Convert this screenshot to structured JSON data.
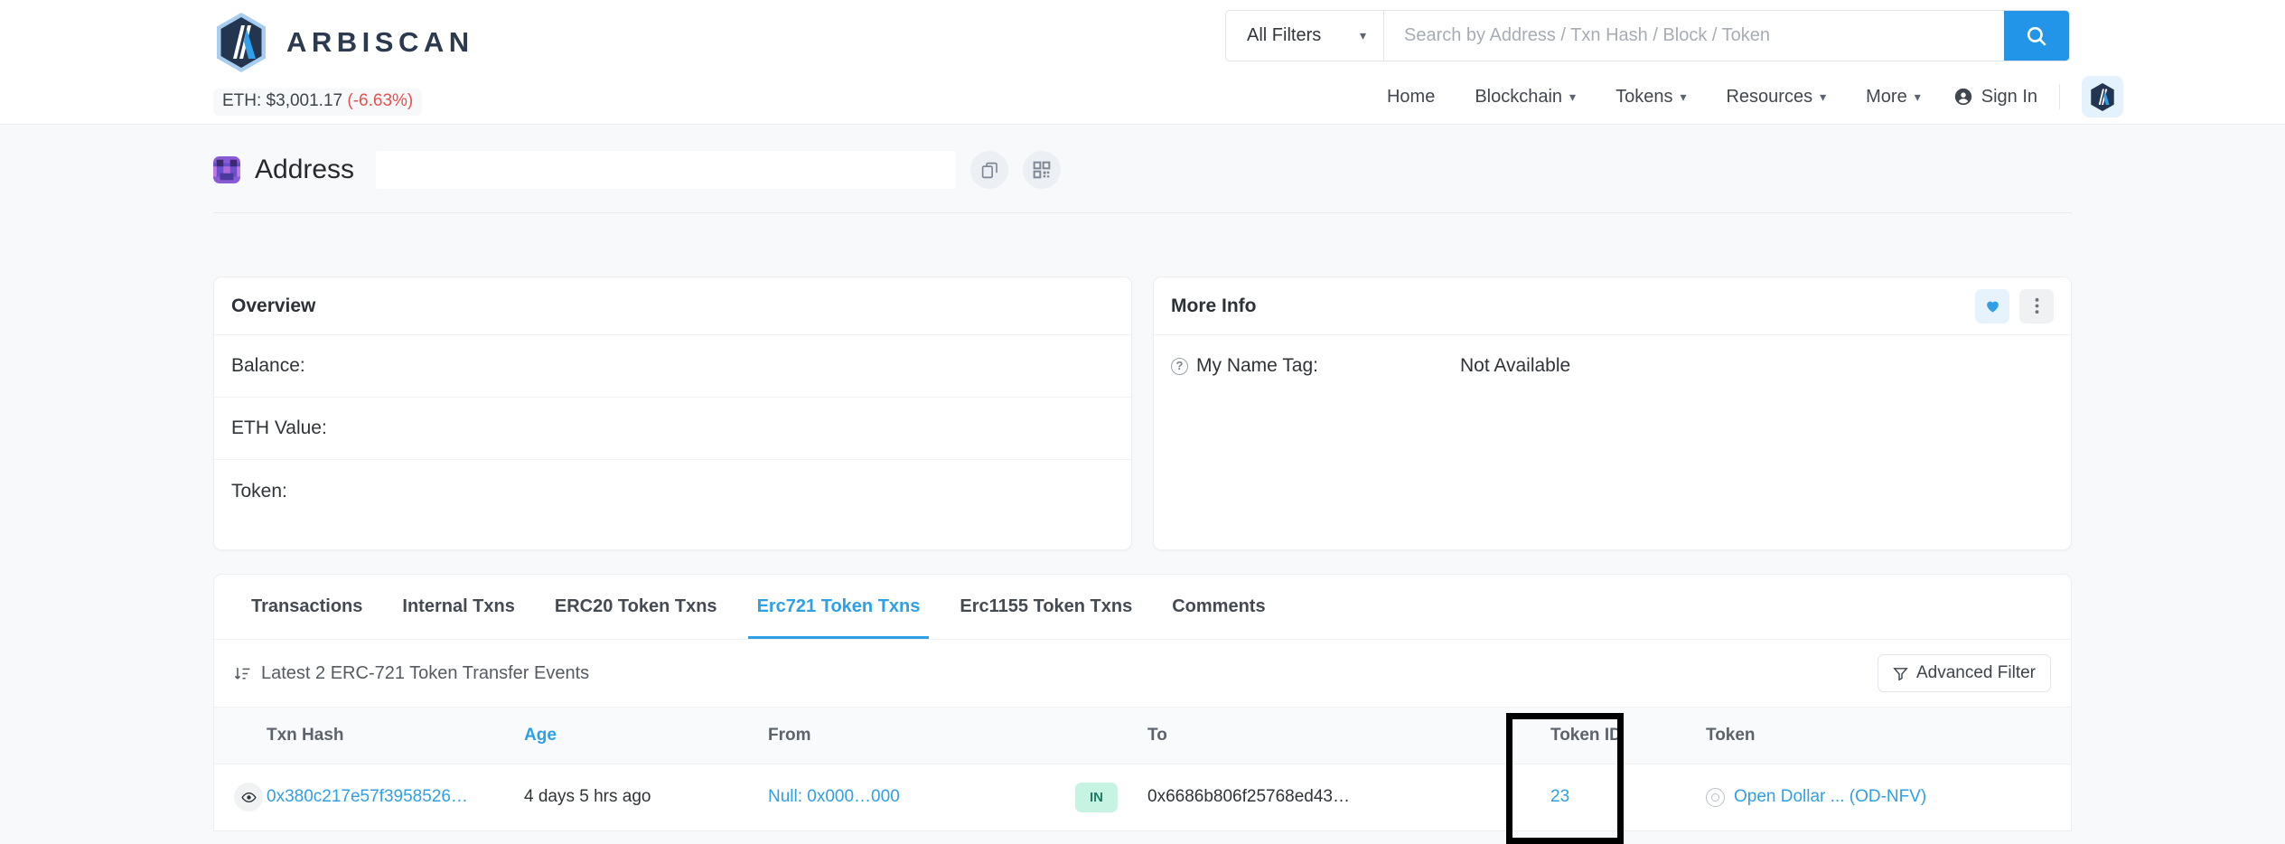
{
  "brand": {
    "name": "ARBISCAN",
    "logo_icon": "arbiscan-logo-icon"
  },
  "ticker": {
    "label": "ETH: $3,001.17",
    "delta": "(-6.63%)",
    "delta_color": "#e8504e"
  },
  "search": {
    "filters_label": "All Filters",
    "placeholder": "Search by Address / Txn Hash / Block / Token",
    "value": "",
    "search_icon": "search-icon",
    "accent": "#2295e8"
  },
  "nav": {
    "items": [
      {
        "label": "Home",
        "has_caret": false
      },
      {
        "label": "Blockchain",
        "has_caret": true
      },
      {
        "label": "Tokens",
        "has_caret": true
      },
      {
        "label": "Resources",
        "has_caret": true
      },
      {
        "label": "More",
        "has_caret": true
      }
    ],
    "sign_in": "Sign In",
    "network_button_icon": "arbiscan-network-icon"
  },
  "address": {
    "title": "Address",
    "value": "",
    "avatar_icon": "identicon-avatar",
    "copy_icon": "copy-icon",
    "qr_icon": "qr-code-icon"
  },
  "overview": {
    "title": "Overview",
    "rows": [
      {
        "label": "Balance:",
        "value": ""
      },
      {
        "label": "ETH Value:",
        "value": ""
      },
      {
        "label": "Token:",
        "value": ""
      }
    ]
  },
  "more_info": {
    "title": "More Info",
    "heart_icon": "heart-icon",
    "menu_icon": "three-dots-icon",
    "rows": [
      {
        "label": "My Name Tag:",
        "value": "Not Available",
        "help_icon": "question-mark-icon"
      }
    ]
  },
  "tabs": [
    {
      "label": "Transactions",
      "active": false
    },
    {
      "label": "Internal Txns",
      "active": false
    },
    {
      "label": "ERC20 Token Txns",
      "active": false
    },
    {
      "label": "Erc721 Token Txns",
      "active": true
    },
    {
      "label": "Erc1155 Token Txns",
      "active": false
    },
    {
      "label": "Comments",
      "active": false
    }
  ],
  "filterbar": {
    "sort_icon": "sort-descending-icon",
    "latest_label": "Latest 2 ERC-721 Token Transfer Events",
    "advanced_filter_label": "Advanced Filter",
    "filter_icon": "funnel-icon"
  },
  "table": {
    "columns": [
      {
        "key": "eye",
        "label": "",
        "sortable": false
      },
      {
        "key": "hash",
        "label": "Txn Hash",
        "sortable": false
      },
      {
        "key": "age",
        "label": "Age",
        "sortable": true
      },
      {
        "key": "from",
        "label": "From",
        "sortable": false
      },
      {
        "key": "dir",
        "label": "",
        "sortable": false
      },
      {
        "key": "to",
        "label": "To",
        "sortable": false
      },
      {
        "key": "tid",
        "label": "Token ID",
        "sortable": false
      },
      {
        "key": "token",
        "label": "Token",
        "sortable": false
      }
    ],
    "rows": [
      {
        "eye_icon": "eye-icon",
        "hash": "0x380c217e57f3958526…",
        "age": "4 days 5 hrs ago",
        "from": "Null: 0x000…000",
        "direction": "IN",
        "to": "0x6686b806f25768ed43…",
        "token_id": "23",
        "token": "Open Dollar ... (OD-NFV)",
        "token_icon": "token-logo-icon"
      }
    ]
  },
  "annotation": {
    "target": "token-id-column",
    "style": "black-rectangle-highlight"
  }
}
